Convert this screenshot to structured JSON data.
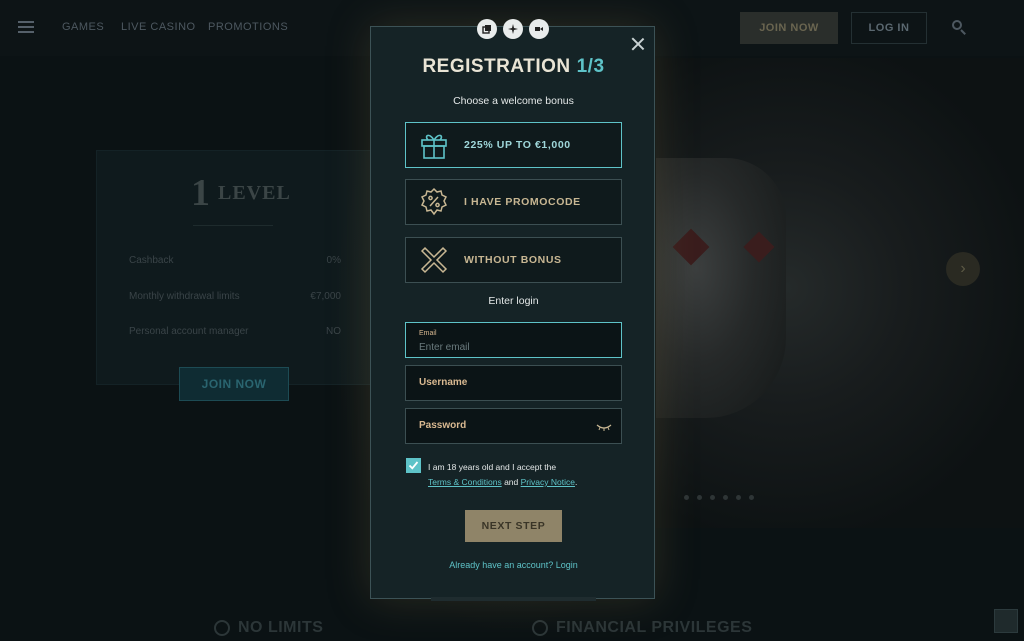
{
  "header": {
    "nav": [
      "GAMES",
      "LIVE CASINO",
      "PROMOTIONS"
    ],
    "join_now": "JOIN NOW",
    "log_in": "LOG IN"
  },
  "level_card": {
    "level_number": "1",
    "level_word": "LEVEL",
    "rows": [
      {
        "label": "Cashback",
        "value": "0%"
      },
      {
        "label": "Monthly withdrawal limits",
        "value": "€7,000"
      },
      {
        "label": "Personal account manager",
        "value": "NO"
      }
    ],
    "join_now": "JOIN NOW"
  },
  "features": [
    "NO LIMITS",
    "FINANCIAL PRIVILEGES"
  ],
  "modal": {
    "title": "REGISTRATION",
    "step": "1/3",
    "choose_bonus": "Choose a welcome bonus",
    "bonuses": [
      {
        "label": "225% UP TO €1,000",
        "icon": "gift-icon",
        "selected": true
      },
      {
        "label": "I HAVE PROMOCODE",
        "icon": "percent-badge-icon",
        "selected": false
      },
      {
        "label": "WITHOUT BONUS",
        "icon": "x-mark-icon",
        "selected": false
      }
    ],
    "enter_login": "Enter login",
    "email": {
      "label": "Email",
      "placeholder": "Enter email",
      "value": ""
    },
    "username": {
      "placeholder": "Username"
    },
    "password": {
      "placeholder": "Password"
    },
    "agree_prefix": "I am 18 years old and I accept the",
    "terms_link": "Terms & Conditions",
    "and": "and",
    "privacy_link": "Privacy Notice",
    "period": ".",
    "next_step": "NEXT STEP",
    "login_link": "Already have an account? Login"
  },
  "colors": {
    "accent": "#5ec3c8",
    "gold": "#c8b793",
    "modal_bg": "#152326"
  }
}
